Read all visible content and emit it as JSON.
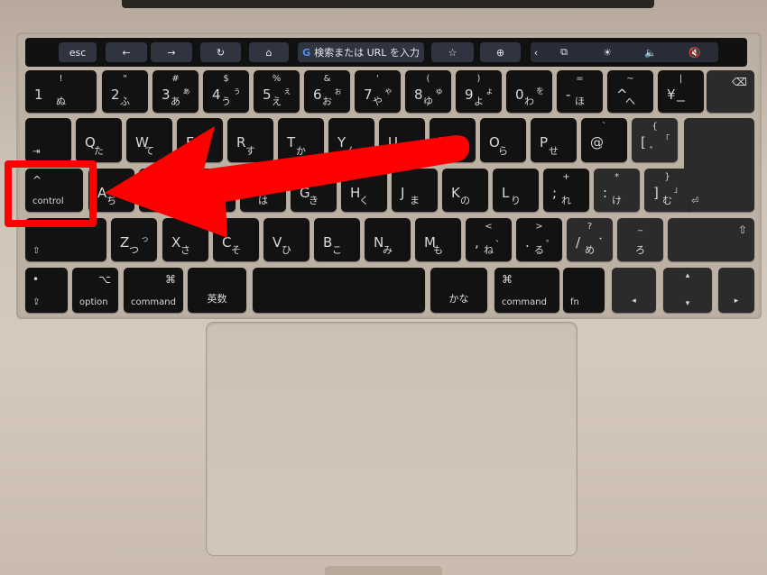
{
  "touchbar": {
    "esc": "esc",
    "back": "←",
    "forward": "→",
    "reload": "↻",
    "home": "⌂",
    "search_placeholder": "検索または URL を入力",
    "search_logo": "G",
    "bookmark": "☆",
    "new_tab": "⊕",
    "collapse": "‹",
    "mirror": "⧉",
    "brightness": "☀",
    "volume": "🔈",
    "mute": "🔇"
  },
  "keyboard": {
    "rows": [
      [
        {
          "p": "1",
          "s": "!",
          "k": "ぬ"
        },
        {
          "p": "2",
          "s": "\"",
          "k": "ふ"
        },
        {
          "p": "3",
          "s": "#",
          "k": "あ",
          "k2": "ぁ"
        },
        {
          "p": "4",
          "s": "$",
          "k": "う",
          "k2": "ぅ"
        },
        {
          "p": "5",
          "s": "%",
          "k": "え",
          "k2": "ぇ"
        },
        {
          "p": "6",
          "s": "&",
          "k": "お",
          "k2": "ぉ"
        },
        {
          "p": "7",
          "s": "'",
          "k": "や",
          "k2": "ゃ"
        },
        {
          "p": "8",
          "s": "(",
          "k": "ゆ",
          "k2": "ゅ"
        },
        {
          "p": "9",
          "s": ")",
          "k": "よ",
          "k2": "ょ"
        },
        {
          "p": "0",
          "k": "わ",
          "k2": "を"
        },
        {
          "p": "-",
          "s": "=",
          "k": "ほ"
        },
        {
          "p": "^",
          "s": "~",
          "k": "へ"
        },
        {
          "p": "¥",
          "s": "|",
          "k": "ー"
        },
        {
          "sym": "⌫",
          "name": "delete"
        }
      ],
      [
        {
          "mod": "⇥",
          "name": "tab"
        },
        {
          "p": "Q",
          "k": "た"
        },
        {
          "p": "W",
          "k": "て"
        },
        {
          "p": "E",
          "k": "い"
        },
        {
          "p": "R",
          "k": "す"
        },
        {
          "p": "T",
          "k": "か"
        },
        {
          "p": "Y",
          "k": "ん"
        },
        {
          "p": "U",
          "k": "な"
        },
        {
          "p": "I",
          "k": "に"
        },
        {
          "p": "O",
          "k": "ら"
        },
        {
          "p": "P",
          "k": "せ"
        },
        {
          "p": "@",
          "s": "`",
          "k": "゛"
        },
        {
          "p": "[",
          "s": "{",
          "k": "゜",
          "k2": "「"
        },
        {
          "mod": "⏎",
          "name": "return"
        }
      ],
      [
        {
          "syml": "^",
          "mod": "control",
          "name": "control"
        },
        {
          "p": "A",
          "k": "ち"
        },
        {
          "p": "S",
          "k": "と"
        },
        {
          "p": "D",
          "k": "し"
        },
        {
          "p": "F",
          "k": "は"
        },
        {
          "p": "G",
          "k": "き"
        },
        {
          "p": "H",
          "k": "く"
        },
        {
          "p": "J",
          "k": "ま"
        },
        {
          "p": "K",
          "k": "の"
        },
        {
          "p": "L",
          "k": "り"
        },
        {
          "p": ";",
          "s": "+",
          "k": "れ"
        },
        {
          "p": ":",
          "s": "*",
          "k": "け"
        },
        {
          "p": "]",
          "s": "}",
          "k": "む",
          "k2": "」"
        }
      ],
      [
        {
          "mod": "⇧",
          "name": "shift-left"
        },
        {
          "p": "Z",
          "k": "つ",
          "k2": "っ"
        },
        {
          "p": "X",
          "k": "さ"
        },
        {
          "p": "C",
          "k": "そ"
        },
        {
          "p": "V",
          "k": "ひ"
        },
        {
          "p": "B",
          "k": "こ"
        },
        {
          "p": "N",
          "k": "み"
        },
        {
          "p": "M",
          "k": "も"
        },
        {
          "p": ",",
          "s": "<",
          "k": "ね",
          "k2": "、"
        },
        {
          "p": ".",
          "s": ">",
          "k": "る",
          "k2": "。"
        },
        {
          "p": "/",
          "s": "?",
          "k": "め",
          "k2": "・"
        },
        {
          "s": "_",
          "k": "ろ"
        },
        {
          "sym": "⇧",
          "name": "shift-right"
        }
      ],
      [
        {
          "syml": "•",
          "mod": "⇪",
          "name": "caps-lock"
        },
        {
          "sym": "⌥",
          "mod": "option",
          "name": "option"
        },
        {
          "sym": "⌘",
          "mod": "command",
          "name": "command-left"
        },
        {
          "modc": "英数",
          "name": "eisu"
        },
        {
          "name": "space"
        },
        {
          "modc": "かな",
          "name": "kana"
        },
        {
          "syml": "⌘",
          "mod": "command",
          "name": "command-right"
        },
        {
          "mod": "fn",
          "name": "fn"
        },
        {
          "modc": "◂",
          "name": "arrow-left"
        },
        {
          "s": "▴",
          "k": "▾",
          "name": "arrow-up-down"
        },
        {
          "modc": "▸",
          "name": "arrow-right"
        }
      ]
    ]
  },
  "annotation": {
    "color": "#ff0000",
    "highlighted_key": "control"
  }
}
